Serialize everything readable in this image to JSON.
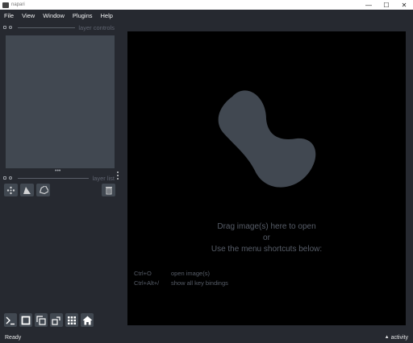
{
  "window": {
    "title": "napari",
    "minimize_glyph": "—",
    "maximize_glyph": "☐",
    "close_glyph": "✕"
  },
  "menubar": {
    "items": [
      "File",
      "View",
      "Window",
      "Plugins",
      "Help"
    ]
  },
  "layer_controls": {
    "label": "layer controls"
  },
  "layer_list": {
    "label": "layer list",
    "splitter_glyph": "•••",
    "buttons": [
      {
        "name": "new-points-button",
        "icon": "points-icon"
      },
      {
        "name": "new-shapes-button",
        "icon": "shapes-icon"
      },
      {
        "name": "new-labels-button",
        "icon": "labels-icon"
      },
      {
        "name": "delete-layer-button",
        "icon": "trash-icon"
      }
    ]
  },
  "bottom_toolbar": {
    "buttons": [
      {
        "name": "console-button",
        "icon": "console-icon"
      },
      {
        "name": "ndisplay-button",
        "icon": "square-icon"
      },
      {
        "name": "roll-dims-button",
        "icon": "roll-icon"
      },
      {
        "name": "transpose-dims-button",
        "icon": "transpose-icon"
      },
      {
        "name": "grid-view-button",
        "icon": "grid-icon"
      },
      {
        "name": "home-button",
        "icon": "home-icon"
      }
    ]
  },
  "canvas": {
    "welcome_line1": "Drag image(s) here to open",
    "welcome_line2": "or",
    "welcome_line3": "Use the menu shortcuts below:",
    "shortcuts": [
      {
        "key": "Ctrl+O",
        "action": "open image(s)"
      },
      {
        "key": "Ctrl+Alt+/",
        "action": "show all key bindings"
      }
    ]
  },
  "status": {
    "text": "Ready",
    "activity_label": "activity",
    "activity_caret": "▲"
  },
  "colors": {
    "background": "#262930",
    "panel": "#414851",
    "canvas": "#000000",
    "logo": "#414851",
    "welcome_text": "#575d68"
  }
}
